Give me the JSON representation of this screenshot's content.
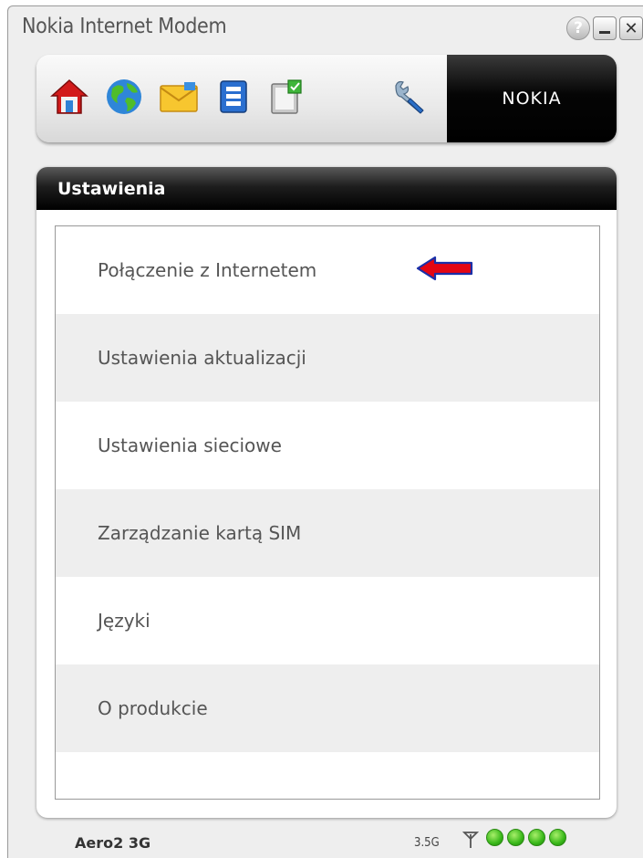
{
  "window": {
    "title": "Nokia Internet Modem",
    "controls": {
      "help": "?",
      "close": "✕"
    }
  },
  "toolbar": {
    "icons": [
      "home-icon",
      "globe-icon",
      "mail-icon",
      "contacts-icon",
      "notepad-icon",
      "wrench-icon"
    ],
    "brand": "NOKIA"
  },
  "panel": {
    "title": "Ustawienia",
    "items": [
      "Połączenie z Internetem",
      "Ustawienia aktualizacji",
      "Ustawienia sieciowe",
      "Zarządzanie kartą SIM",
      "Języki",
      "O produkcie"
    ]
  },
  "status": {
    "network": "Aero2 3G",
    "technology": "3.5G",
    "signal_bars": 4,
    "signal_color": "#3cbf1e"
  },
  "colors": {
    "header_bg": "#000000",
    "arrow": "#e30613",
    "row_alt": "#eeeeee"
  }
}
